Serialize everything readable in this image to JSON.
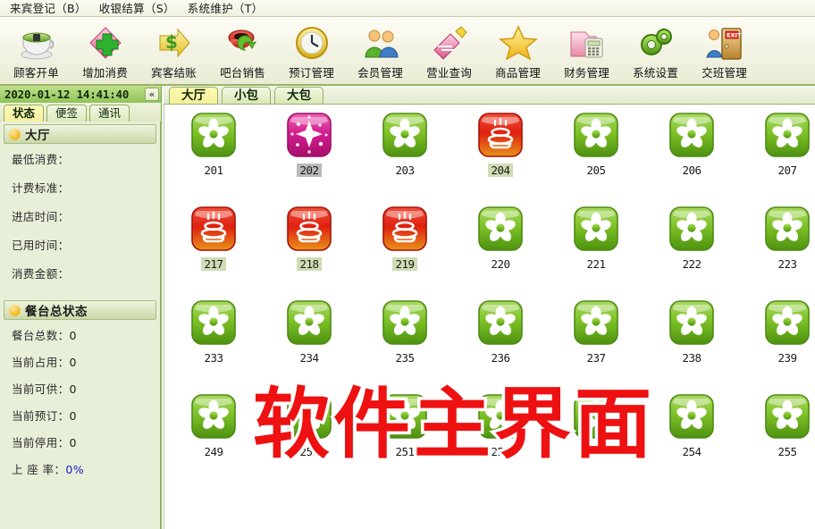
{
  "menu": {
    "items": [
      {
        "label": "来宾登记（B）",
        "name": "menu-guest-registration"
      },
      {
        "label": "收银结算（S）",
        "name": "menu-cashier-settlement"
      },
      {
        "label": "系统维护（T）",
        "name": "menu-system-maintenance"
      }
    ]
  },
  "toolbar": {
    "buttons": [
      {
        "label": "顾客开单",
        "icon": "teacup-icon"
      },
      {
        "label": "增加消费",
        "icon": "add-plus-icon"
      },
      {
        "label": "宾客结账",
        "icon": "dollar-arrow-icon"
      },
      {
        "label": "吧台销售",
        "icon": "coffee-refresh-icon"
      },
      {
        "label": "预订管理",
        "icon": "clock-icon"
      },
      {
        "label": "会员管理",
        "icon": "members-icon"
      },
      {
        "label": "营业查询",
        "icon": "chart-pencil-icon"
      },
      {
        "label": "商品管理",
        "icon": "star-icon"
      },
      {
        "label": "财务管理",
        "icon": "folder-calculator-icon"
      },
      {
        "label": "系统设置",
        "icon": "gears-icon"
      },
      {
        "label": "交班管理",
        "icon": "exit-door-icon"
      }
    ]
  },
  "statusbar": {
    "datetime": "2020-01-12  14:41:40",
    "collapse_label": "«"
  },
  "sidebar": {
    "tabs": [
      {
        "label": "状态",
        "active": true
      },
      {
        "label": "便签",
        "active": false
      },
      {
        "label": "通讯",
        "active": false
      }
    ],
    "groups": [
      {
        "title": "大厅",
        "fields": [
          {
            "label": "最低消费：",
            "value": ""
          },
          {
            "label": "计费标准：",
            "value": ""
          },
          {
            "label": "进店时间：",
            "value": ""
          },
          {
            "label": "已用时间：",
            "value": ""
          },
          {
            "label": "消费金额：",
            "value": ""
          }
        ]
      },
      {
        "title": "餐台总状态",
        "fields": [
          {
            "label": "餐台总数：",
            "value": "0"
          },
          {
            "label": "当前占用：",
            "value": "0"
          },
          {
            "label": "当前可供：",
            "value": "0"
          },
          {
            "label": "当前预订：",
            "value": "0"
          },
          {
            "label": "当前停用：",
            "value": "0"
          },
          {
            "label": "上 座 率：",
            "value": "0%",
            "blue": true
          }
        ]
      }
    ]
  },
  "main": {
    "tabs": [
      {
        "label": "大厅",
        "active": true
      },
      {
        "label": "小包",
        "active": false
      },
      {
        "label": "大包",
        "active": false
      }
    ],
    "watermark": "软件主界面",
    "tables": [
      [
        {
          "number": "201",
          "state": "free",
          "highlight": "none"
        },
        {
          "number": "202",
          "state": "reserved",
          "highlight": "gray"
        },
        {
          "number": "203",
          "state": "free",
          "highlight": "none"
        },
        {
          "number": "204",
          "state": "occupied",
          "highlight": "green"
        },
        {
          "number": "205",
          "state": "free",
          "highlight": "none"
        },
        {
          "number": "206",
          "state": "free",
          "highlight": "none"
        },
        {
          "number": "207",
          "state": "free",
          "highlight": "none"
        }
      ],
      [
        {
          "number": "217",
          "state": "occupied",
          "highlight": "green"
        },
        {
          "number": "218",
          "state": "occupied",
          "highlight": "green"
        },
        {
          "number": "219",
          "state": "occupied",
          "highlight": "green"
        },
        {
          "number": "220",
          "state": "free",
          "highlight": "none"
        },
        {
          "number": "221",
          "state": "free",
          "highlight": "none"
        },
        {
          "number": "222",
          "state": "free",
          "highlight": "none"
        },
        {
          "number": "223",
          "state": "free",
          "highlight": "none"
        }
      ],
      [
        {
          "number": "233",
          "state": "free",
          "highlight": "none"
        },
        {
          "number": "234",
          "state": "free",
          "highlight": "none"
        },
        {
          "number": "235",
          "state": "free",
          "highlight": "none"
        },
        {
          "number": "236",
          "state": "free",
          "highlight": "none"
        },
        {
          "number": "237",
          "state": "free",
          "highlight": "none"
        },
        {
          "number": "238",
          "state": "free",
          "highlight": "none"
        },
        {
          "number": "239",
          "state": "free",
          "highlight": "none"
        }
      ],
      [
        {
          "number": "249",
          "state": "free",
          "highlight": "none"
        },
        {
          "number": "250",
          "state": "free",
          "highlight": "none"
        },
        {
          "number": "251",
          "state": "free",
          "highlight": "none"
        },
        {
          "number": "252",
          "state": "free",
          "highlight": "none"
        },
        {
          "number": "253",
          "state": "free",
          "highlight": "none"
        },
        {
          "number": "254",
          "state": "free",
          "highlight": "none"
        },
        {
          "number": "255",
          "state": "free",
          "highlight": "none"
        }
      ]
    ]
  },
  "colors": {
    "free": "#78c128",
    "occupied": "#e02718",
    "reserved": "#d51e8e",
    "accent_green": "#8fae5e",
    "watermark_red": "#ee1111"
  }
}
